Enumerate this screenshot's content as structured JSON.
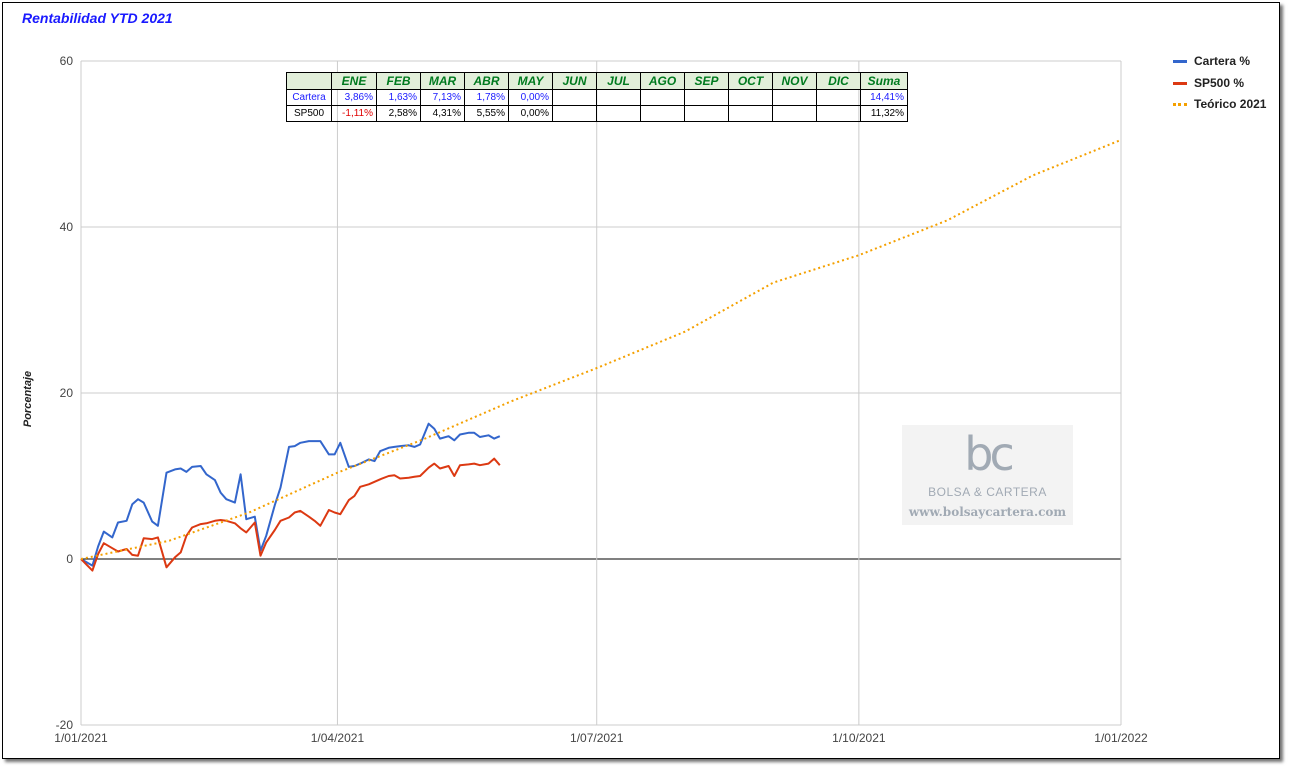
{
  "title": "Rentabilidad YTD 2021",
  "chart_data": {
    "type": "line",
    "title": "Rentabilidad YTD 2021",
    "ylabel": "Porcentaje",
    "xlabel": "",
    "ylim": [
      -20,
      60
    ],
    "yticks": [
      "60",
      "40",
      "20",
      "0",
      "-20"
    ],
    "ytick_values": [
      60,
      40,
      20,
      0,
      -20
    ],
    "xlim": [
      "2021-01-01",
      "2022-01-01"
    ],
    "xticks": [
      "1/01/2021",
      "1/04/2021",
      "1/07/2021",
      "1/10/2021",
      "1/01/2022"
    ],
    "xtick_dates": [
      "2021-01-01",
      "2021-04-01",
      "2021-07-01",
      "2021-10-01",
      "2022-01-01"
    ],
    "grid": true,
    "legend_position": "right",
    "series": [
      {
        "name": "Cartera %",
        "color": "#3366cc",
        "style": "solid",
        "x": [
          "2021-01-01",
          "2021-01-05",
          "2021-01-07",
          "2021-01-09",
          "2021-01-12",
          "2021-01-14",
          "2021-01-17",
          "2021-01-19",
          "2021-01-21",
          "2021-01-23",
          "2021-01-26",
          "2021-01-28",
          "2021-01-31",
          "2021-02-03",
          "2021-02-05",
          "2021-02-07",
          "2021-02-09",
          "2021-02-12",
          "2021-02-14",
          "2021-02-17",
          "2021-02-19",
          "2021-02-21",
          "2021-02-24",
          "2021-02-26",
          "2021-02-28",
          "2021-03-03",
          "2021-03-05",
          "2021-03-07",
          "2021-03-10",
          "2021-03-12",
          "2021-03-15",
          "2021-03-17",
          "2021-03-19",
          "2021-03-22",
          "2021-03-24",
          "2021-03-26",
          "2021-03-29",
          "2021-03-31",
          "2021-04-02",
          "2021-04-05",
          "2021-04-07",
          "2021-04-09",
          "2021-04-12",
          "2021-04-14",
          "2021-04-16",
          "2021-04-19",
          "2021-04-21",
          "2021-04-23",
          "2021-04-26",
          "2021-04-28",
          "2021-04-30",
          "2021-05-03",
          "2021-05-05",
          "2021-05-07",
          "2021-05-10",
          "2021-05-12",
          "2021-05-14",
          "2021-05-17",
          "2021-05-19",
          "2021-05-21",
          "2021-05-24",
          "2021-05-26",
          "2021-05-28"
        ],
        "values": [
          0,
          -0.8,
          1.5,
          3.3,
          2.6,
          4.4,
          4.6,
          6.6,
          7.2,
          6.8,
          4.5,
          4.0,
          10.4,
          10.8,
          10.9,
          10.5,
          11.1,
          11.2,
          10.2,
          9.5,
          8.0,
          7.2,
          6.8,
          10.2,
          4.8,
          5.1,
          1.0,
          2.8,
          6.5,
          8.6,
          13.5,
          13.6,
          14.0,
          14.2,
          14.2,
          14.2,
          12.6,
          12.6,
          14.0,
          11.1,
          11.2,
          11.5,
          12.0,
          11.8,
          13.0,
          13.4,
          13.5,
          13.6,
          13.7,
          13.5,
          13.8,
          16.3,
          15.7,
          14.5,
          14.8,
          14.3,
          15.0,
          15.2,
          15.2,
          14.7,
          14.9,
          14.5,
          14.8
        ]
      },
      {
        "name": "SP500 %",
        "color": "#dc3912",
        "style": "solid",
        "x": [
          "2021-01-01",
          "2021-01-05",
          "2021-01-07",
          "2021-01-09",
          "2021-01-12",
          "2021-01-14",
          "2021-01-17",
          "2021-01-19",
          "2021-01-21",
          "2021-01-23",
          "2021-01-26",
          "2021-01-28",
          "2021-01-31",
          "2021-02-03",
          "2021-02-05",
          "2021-02-07",
          "2021-02-09",
          "2021-02-12",
          "2021-02-14",
          "2021-02-17",
          "2021-02-19",
          "2021-02-21",
          "2021-02-24",
          "2021-02-26",
          "2021-02-28",
          "2021-03-03",
          "2021-03-05",
          "2021-03-07",
          "2021-03-10",
          "2021-03-12",
          "2021-03-15",
          "2021-03-17",
          "2021-03-19",
          "2021-03-22",
          "2021-03-24",
          "2021-03-26",
          "2021-03-29",
          "2021-03-31",
          "2021-04-02",
          "2021-04-05",
          "2021-04-07",
          "2021-04-09",
          "2021-04-12",
          "2021-04-14",
          "2021-04-16",
          "2021-04-19",
          "2021-04-21",
          "2021-04-23",
          "2021-04-26",
          "2021-04-28",
          "2021-04-30",
          "2021-05-03",
          "2021-05-05",
          "2021-05-07",
          "2021-05-10",
          "2021-05-12",
          "2021-05-14",
          "2021-05-17",
          "2021-05-19",
          "2021-05-21",
          "2021-05-24",
          "2021-05-26",
          "2021-05-28"
        ],
        "values": [
          0,
          -1.4,
          0.6,
          1.9,
          1.3,
          0.9,
          1.2,
          0.5,
          0.4,
          2.5,
          2.4,
          2.6,
          -1.0,
          0.2,
          0.8,
          2.8,
          3.8,
          4.2,
          4.3,
          4.6,
          4.7,
          4.6,
          4.3,
          3.7,
          3.2,
          4.4,
          0.4,
          2.0,
          3.5,
          4.6,
          5.0,
          5.6,
          5.8,
          5.1,
          4.6,
          4.0,
          5.9,
          5.6,
          5.4,
          7.1,
          7.6,
          8.7,
          9.0,
          9.3,
          9.6,
          10.0,
          10.1,
          9.7,
          9.8,
          9.9,
          10.0,
          11.0,
          11.5,
          10.9,
          11.2,
          10.0,
          11.3,
          11.4,
          11.5,
          11.3,
          11.5,
          12.1,
          11.3
        ]
      },
      {
        "name": "Teórico 2021",
        "color": "#f4a000",
        "style": "dotted",
        "x": [
          "2021-01-01",
          "2021-02-01",
          "2021-03-01",
          "2021-04-01",
          "2021-05-01",
          "2021-06-01",
          "2021-07-01",
          "2021-08-01",
          "2021-09-01",
          "2021-10-01",
          "2021-11-01",
          "2021-12-01",
          "2022-01-01"
        ],
        "values": [
          0,
          2.2,
          5.6,
          10.4,
          14.4,
          19.0,
          23.0,
          27.4,
          33.3,
          36.6,
          40.8,
          46.2,
          50.5
        ]
      }
    ],
    "table": {
      "headers": [
        "",
        "ENE",
        "FEB",
        "MAR",
        "ABR",
        "MAY",
        "JUN",
        "JUL",
        "AGO",
        "SEP",
        "OCT",
        "NOV",
        "DIC",
        "Suma"
      ],
      "rows": [
        {
          "label": "Cartera",
          "color": "#1a1aff",
          "cells": [
            "3,86%",
            "1,63%",
            "7,13%",
            "1,78%",
            "0,00%",
            "",
            "",
            "",
            "",
            "",
            "",
            "",
            "14,41%"
          ],
          "cell_colors": [
            "#1a1aff",
            "#1a1aff",
            "#1a1aff",
            "#1a1aff",
            "#1a1aff",
            "",
            "",
            "",
            "",
            "",
            "",
            "",
            "#1a1aff"
          ]
        },
        {
          "label": "SP500",
          "color": "#000000",
          "cells": [
            "-1,11%",
            "2,58%",
            "4,31%",
            "5,55%",
            "0,00%",
            "",
            "",
            "",
            "",
            "",
            "",
            "",
            "11,32%"
          ],
          "cell_colors": [
            "#e00000",
            "#000000",
            "#000000",
            "#000000",
            "#000000",
            "",
            "",
            "",
            "",
            "",
            "",
            "",
            "#000000"
          ]
        }
      ]
    }
  },
  "watermark": {
    "logo": "bc",
    "name": "BOLSA & CARTERA",
    "url": "www.bolsaycartera.com"
  }
}
